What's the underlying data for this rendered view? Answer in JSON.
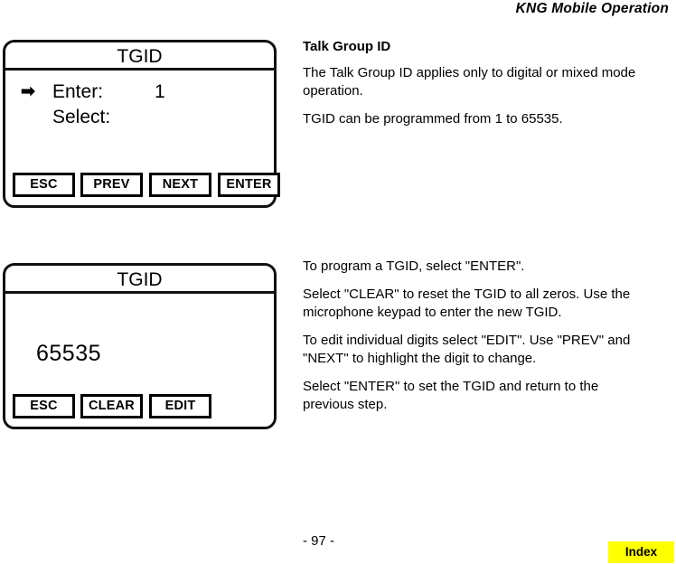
{
  "header": {
    "title": "KNG Mobile Operation"
  },
  "screens": [
    {
      "id": "tgid-enter-screen",
      "title": "TGID",
      "rows": [
        {
          "arrow": "➡",
          "label": "Enter:",
          "value": "1"
        },
        {
          "arrow": "",
          "label": "Select:",
          "value": ""
        }
      ],
      "softkeys": [
        "ESC",
        "PREV",
        "NEXT",
        "ENTER"
      ]
    },
    {
      "id": "tgid-value-screen",
      "title": "TGID",
      "value": "65535",
      "softkeys": [
        "ESC",
        "CLEAR",
        "EDIT"
      ]
    }
  ],
  "text_top": {
    "heading": "Talk Group ID",
    "paragraphs": [
      "The Talk Group ID applies only to digital or mixed mode operation.",
      "TGID can be programmed from 1 to 65535."
    ]
  },
  "text_bottom": {
    "paragraphs": [
      "To program a TGID, select \"ENTER\".",
      "Select \"CLEAR\" to reset the TGID to all zeros. Use the microphone keypad to enter the new  TGID.",
      "To edit individual digits select \"EDIT\". Use \"PREV\" and \"NEXT\" to highlight the digit to change.",
      "Select \"ENTER\" to set the TGID and return to the previous step."
    ]
  },
  "footer": {
    "page_number": "- 97 -",
    "index_label": "Index",
    "index_color": "#ffff00"
  }
}
